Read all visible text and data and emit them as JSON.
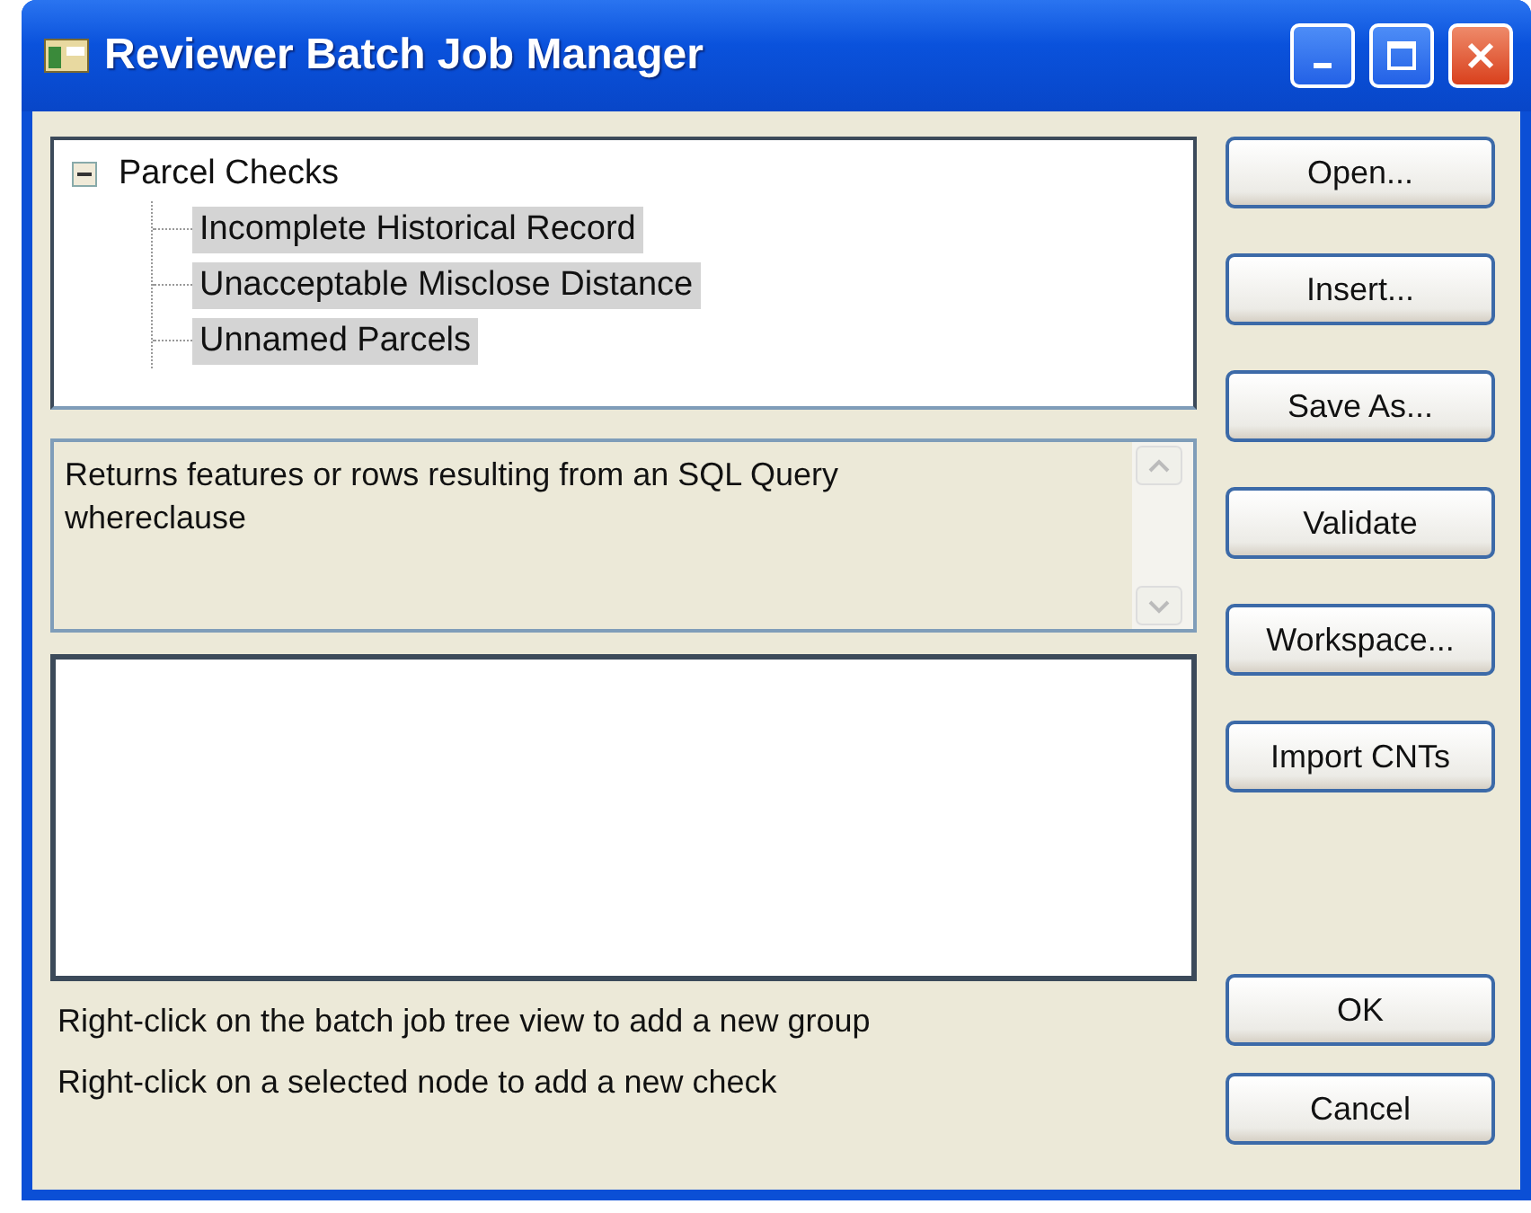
{
  "window": {
    "title": "Reviewer Batch Job Manager"
  },
  "tree": [
    {
      "label": "Parcel Checks",
      "expanded": true,
      "selected": false,
      "children": [
        {
          "label": "Incomplete Historical Record",
          "selected": true
        },
        {
          "label": "Unacceptable Misclose Distance",
          "selected": true
        },
        {
          "label": "Unnamed Parcels",
          "selected": true
        }
      ]
    }
  ],
  "description": "Returns features or rows resulting from an SQL Query whereclause",
  "side_buttons": [
    "Open...",
    "Insert...",
    "Save As...",
    "Validate",
    "Workspace...",
    "Import CNTs"
  ],
  "hints": [
    "Right-click on the batch job tree  view to add a new group",
    "Right-click on a selected node to add a new check"
  ],
  "dialog_buttons": [
    "OK",
    "Cancel"
  ]
}
